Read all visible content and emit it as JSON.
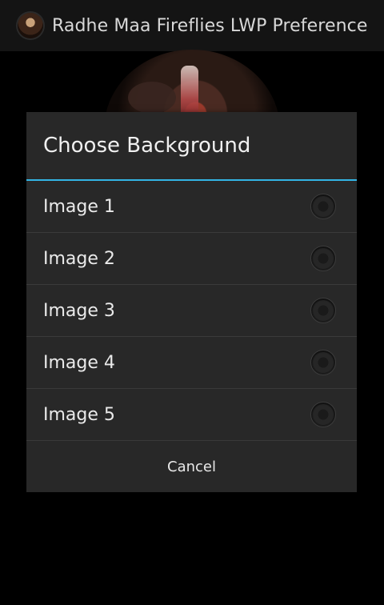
{
  "actionbar": {
    "title": "Radhe Maa Fireflies LWP Preference",
    "icon": "app-avatar-icon"
  },
  "dialog": {
    "title": "Choose Background",
    "options": [
      {
        "label": "Image 1",
        "selected": false
      },
      {
        "label": "Image 2",
        "selected": false
      },
      {
        "label": "Image 3",
        "selected": false
      },
      {
        "label": "Image 4",
        "selected": false
      },
      {
        "label": "Image 5",
        "selected": false
      }
    ],
    "cancel_label": "Cancel",
    "accent_color": "#33b5e5"
  }
}
